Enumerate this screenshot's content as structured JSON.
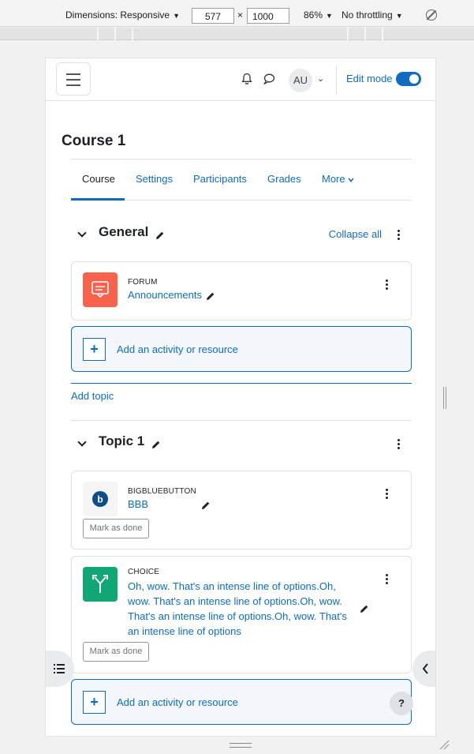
{
  "devtools": {
    "dimensions_label": "Dimensions: Responsive",
    "width_value": "577",
    "times_sign": "×",
    "height_value": "1000",
    "zoom": "86%",
    "throttling": "No throttling"
  },
  "navbar": {
    "avatar_initials": "AU",
    "edit_mode_label": "Edit mode",
    "edit_mode_on": true
  },
  "page": {
    "title": "Course 1"
  },
  "tabs": [
    {
      "label": "Course",
      "active": true
    },
    {
      "label": "Settings"
    },
    {
      "label": "Participants"
    },
    {
      "label": "Grades"
    },
    {
      "label": "More"
    }
  ],
  "sections": {
    "general": {
      "title": "General",
      "collapse_label": "Collapse all",
      "activity": {
        "type": "FORUM",
        "name": "Announcements"
      },
      "add_activity_label": "Add an activity or resource",
      "add_topic_label": "Add topic"
    },
    "topic1": {
      "title": "Topic 1",
      "activities": [
        {
          "type": "BIGBLUEBUTTON",
          "name": "BBB",
          "mark_done": "Mark as done"
        },
        {
          "type": "CHOICE",
          "name_lines": [
            "Oh, wow. That's an intense line of options.Oh,",
            "wow. That's an intense line of options.Oh, wow.",
            "That's an intense line of options.Oh, wow. That's",
            "an intense line of options"
          ],
          "mark_done": "Mark as done"
        }
      ],
      "add_activity_label": "Add an activity or resource"
    }
  },
  "help_label": "?",
  "colors": {
    "accent": "#0f6cbf",
    "forum": "#f7634d",
    "choice": "#11a676",
    "bbb": "#0f4c8a"
  }
}
